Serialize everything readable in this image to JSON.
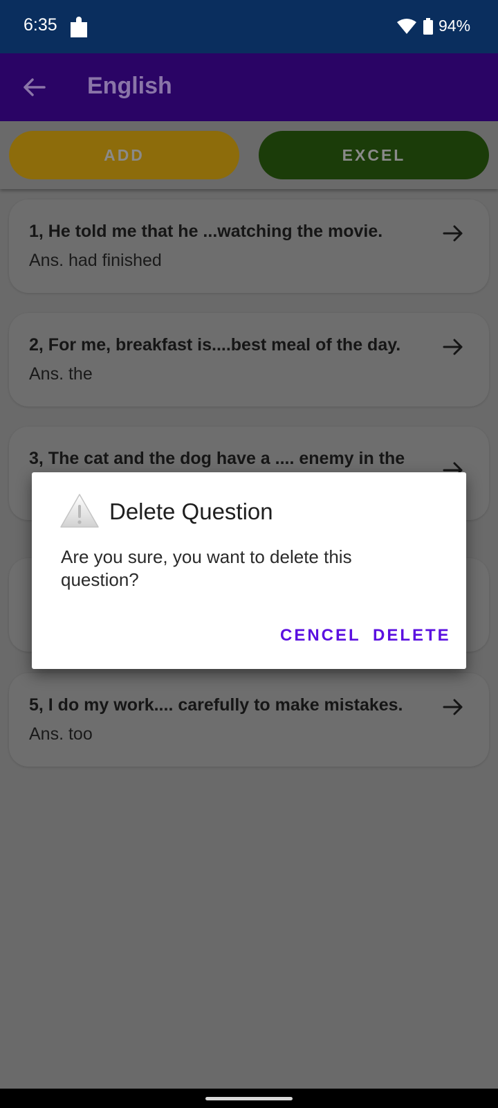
{
  "status_bar": {
    "time": "6:35",
    "battery": "94%"
  },
  "app_bar": {
    "title": "English"
  },
  "toolbar": {
    "add_label": "ADD",
    "excel_label": "EXCEL"
  },
  "questions": [
    {
      "question": "1, He told me that he ...watching the movie.",
      "answer": "Ans. had finished"
    },
    {
      "question": "2, For me, breakfast is....best meal of the day.",
      "answer": "Ans. the"
    },
    {
      "question": "3, The cat and the dog have a .... enemy in the",
      "answer": ""
    },
    {
      "question": "",
      "answer": ""
    },
    {
      "question": "5, I do my work.... carefully to make mistakes.",
      "answer": "Ans. too"
    }
  ],
  "dialog": {
    "title": "Delete Question",
    "message": "Are you sure, you want to delete this question?",
    "cancel_label": "CENCEL",
    "delete_label": "DELETE"
  },
  "colors": {
    "status_bar_bg": "#0a2e5e",
    "app_bar_bg": "#2a0465",
    "add_button": "#8d6c0b",
    "excel_button": "#1b3c09",
    "dialog_accent": "#5b10e0"
  },
  "icons": [
    "puzzle-icon",
    "wifi-icon",
    "battery-icon",
    "back-arrow-icon",
    "forward-arrow-icon",
    "warning-icon"
  ]
}
